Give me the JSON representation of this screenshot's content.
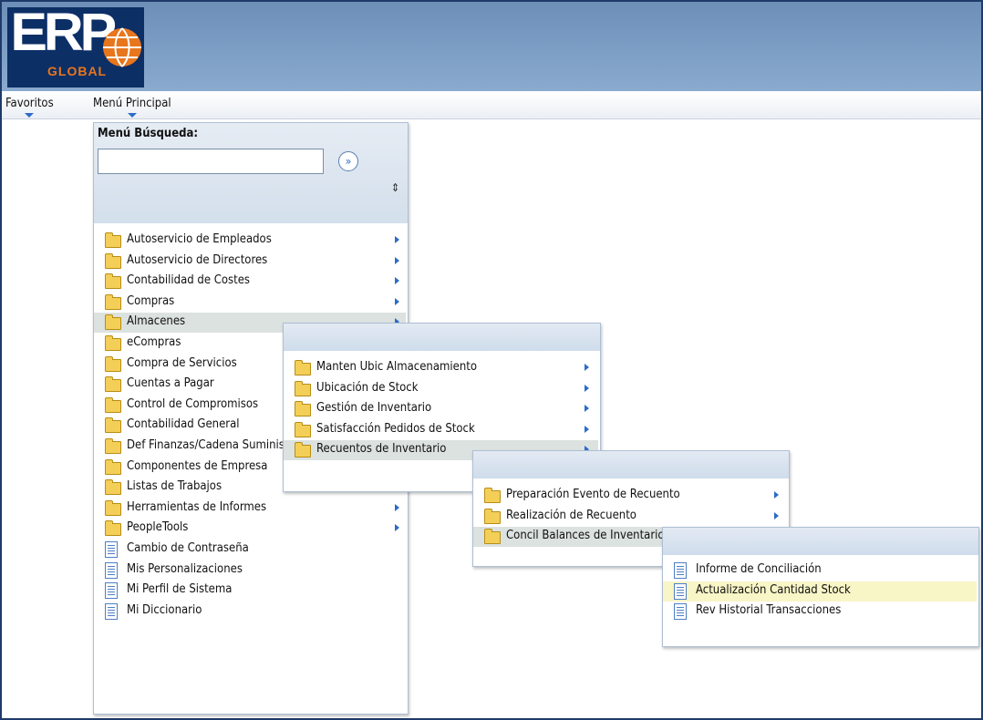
{
  "logo": {
    "text": "ERP",
    "subtext": "GLOBAL"
  },
  "menubar": {
    "favorites": "Favoritos",
    "main_menu": "Menú Principal"
  },
  "search": {
    "label": "Menú Búsqueda:",
    "value": "",
    "go_glyph": "»",
    "sort_glyph": "⇕"
  },
  "main_menu": {
    "items": [
      {
        "label": "Autoservicio de Empleados",
        "icon": "folder-icon",
        "submenu": true
      },
      {
        "label": "Autoservicio de Directores",
        "icon": "folder-icon",
        "submenu": true
      },
      {
        "label": "Contabilidad de Costes",
        "icon": "folder-icon",
        "submenu": true
      },
      {
        "label": "Compras",
        "icon": "folder-icon",
        "submenu": true
      },
      {
        "label": "Almacenes",
        "icon": "folder-icon",
        "submenu": true,
        "highlighted": true
      },
      {
        "label": "eCompras",
        "icon": "folder-icon",
        "submenu": true
      },
      {
        "label": "Compra de Servicios",
        "icon": "folder-icon",
        "submenu": true
      },
      {
        "label": "Cuentas a Pagar",
        "icon": "folder-icon",
        "submenu": true
      },
      {
        "label": "Control de Compromisos",
        "icon": "folder-icon",
        "submenu": true
      },
      {
        "label": "Contabilidad General",
        "icon": "folder-icon",
        "submenu": true
      },
      {
        "label": "Def Finanzas/Cadena Suministro",
        "icon": "folder-icon",
        "submenu": true
      },
      {
        "label": "Componentes de Empresa",
        "icon": "folder-icon",
        "submenu": true
      },
      {
        "label": "Listas de Trabajos",
        "icon": "folder-icon",
        "submenu": true
      },
      {
        "label": "Herramientas de Informes",
        "icon": "folder-icon",
        "submenu": true
      },
      {
        "label": "PeopleTools",
        "icon": "folder-icon",
        "submenu": true
      },
      {
        "label": "Cambio de Contraseña",
        "icon": "document-icon",
        "submenu": false
      },
      {
        "label": "Mis Personalizaciones",
        "icon": "document-icon",
        "submenu": false
      },
      {
        "label": "Mi Perfil de Sistema",
        "icon": "document-icon",
        "submenu": false
      },
      {
        "label": "Mi Diccionario",
        "icon": "document-icon",
        "submenu": false
      }
    ]
  },
  "almacenes_menu": {
    "items": [
      {
        "label": "Manten Ubic Almacenamiento",
        "icon": "folder-icon",
        "submenu": true
      },
      {
        "label": "Ubicación de Stock",
        "icon": "folder-icon",
        "submenu": true
      },
      {
        "label": "Gestión de Inventario",
        "icon": "folder-icon",
        "submenu": true
      },
      {
        "label": "Satisfacción Pedidos de Stock",
        "icon": "folder-icon",
        "submenu": true
      },
      {
        "label": "Recuentos de Inventario",
        "icon": "folder-icon",
        "submenu": true,
        "highlighted": true
      }
    ]
  },
  "recuentos_menu": {
    "items": [
      {
        "label": "Preparación Evento de Recuento",
        "icon": "folder-icon",
        "submenu": true
      },
      {
        "label": "Realización de Recuento",
        "icon": "folder-icon",
        "submenu": true
      },
      {
        "label": "Concil Balances de Inventario",
        "icon": "folder-icon",
        "submenu": true,
        "highlighted": true
      }
    ]
  },
  "concil_menu": {
    "items": [
      {
        "label": "Informe de Conciliación",
        "icon": "document-icon",
        "submenu": false
      },
      {
        "label": "Actualización Cantidad Stock",
        "icon": "document-icon",
        "submenu": false,
        "selected": true
      },
      {
        "label": "Rev Historial Transacciones",
        "icon": "document-icon",
        "submenu": false
      }
    ]
  }
}
